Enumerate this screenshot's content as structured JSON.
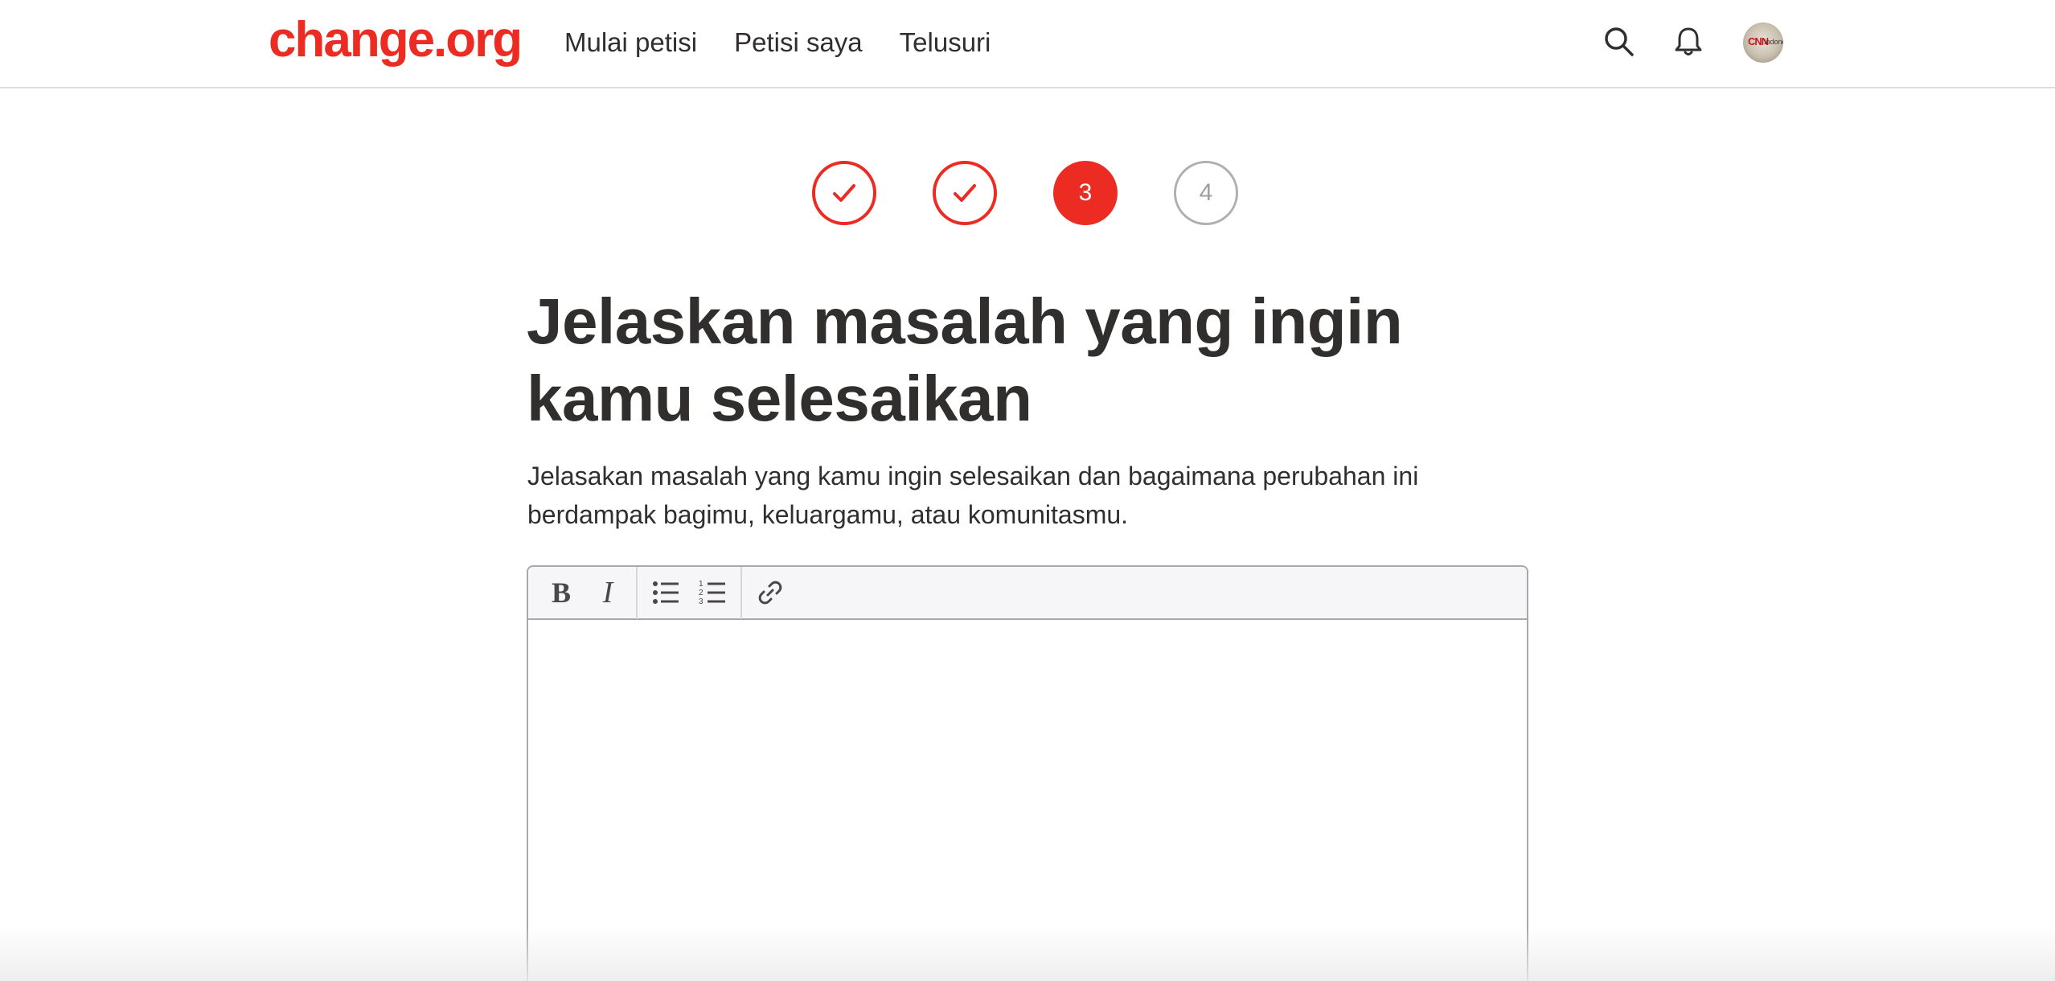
{
  "brand": {
    "logo_text": "change.org",
    "accent_color": "#ec2c22"
  },
  "nav": {
    "items": [
      {
        "label": "Mulai petisi"
      },
      {
        "label": "Petisi saya"
      },
      {
        "label": "Telusuri"
      }
    ]
  },
  "header_icons": {
    "search": "search-icon",
    "notifications": "bell-icon",
    "avatar_text_1": "CNN",
    "avatar_text_2": "Indonesia"
  },
  "steps": {
    "current": 3,
    "total": 4,
    "items": [
      {
        "state": "done",
        "label": ""
      },
      {
        "state": "done",
        "label": ""
      },
      {
        "state": "active",
        "label": "3"
      },
      {
        "state": "todo",
        "label": "4"
      }
    ]
  },
  "page": {
    "title": "Jelaskan masalah yang ingin kamu selesaikan",
    "description": "Jelasakan masalah yang kamu ingin selesaikan dan bagaimana perubahan ini berdampak bagimu, keluargamu, atau komunitasmu."
  },
  "editor": {
    "bold_label": "B",
    "italic_label": "I",
    "value": "",
    "tools": [
      "bold-icon",
      "italic-icon",
      "bulleted-list-icon",
      "numbered-list-icon",
      "link-icon"
    ]
  }
}
